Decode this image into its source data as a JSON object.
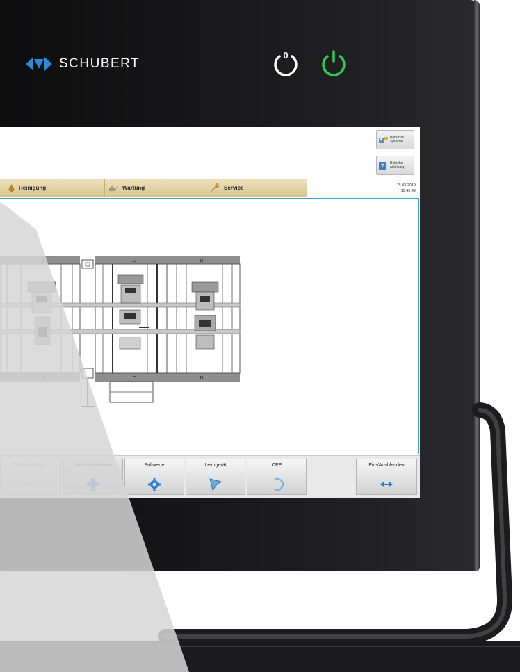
{
  "brand": {
    "name": "SCHUBERT"
  },
  "sidebar_buttons": [
    {
      "label_1": "Benutzer",
      "label_2": "Sprache",
      "icon": "user-flag-icon"
    },
    {
      "label_1": "Betriebs-",
      "label_2": "anleitung",
      "icon": "help-icon"
    }
  ],
  "menu": [
    {
      "label": "Reinigung",
      "icon": "drop-icon"
    },
    {
      "label": "Wartung",
      "icon": "oil-can-icon"
    },
    {
      "label": "Service",
      "icon": "wrench-icon"
    }
  ],
  "datetime": {
    "date": "15.03.2019",
    "time": "10:49:49"
  },
  "diagram": {
    "stations_top": [
      "B",
      "C",
      "D"
    ],
    "stations_bottom": [
      "B",
      "C",
      "D"
    ]
  },
  "function_buttons": [
    {
      "label": "Teilschaltfolgen",
      "icon": "skip-forward-icon",
      "disabled": true
    },
    {
      "label": "Sonderfunktionen",
      "icon": "plus-icon",
      "active": true
    },
    {
      "label": "Sollwerte",
      "icon": "gear-icon"
    },
    {
      "label": "Leimgerät",
      "icon": "glue-gun-icon"
    },
    {
      "label": "OEE",
      "icon": "oee-arc-icon"
    },
    {
      "label": "Ein-/Ausblenden",
      "icon": "expand-horizontal-icon"
    }
  ],
  "colors": {
    "accent": "#3aa3d8",
    "menu_strip": "#e2d3a3",
    "power_on": "#2ecc55"
  }
}
